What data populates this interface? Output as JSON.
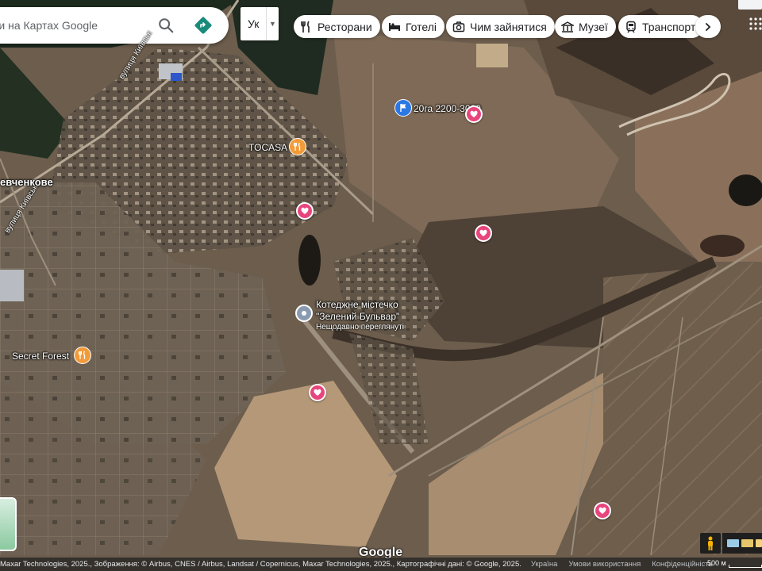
{
  "search": {
    "placeholder": "ти на Картах Google"
  },
  "language": {
    "selected": "Ук"
  },
  "chips": [
    {
      "label": "Ресторани",
      "icon": "fork-knife-icon"
    },
    {
      "label": "Готелі",
      "icon": "bed-icon"
    },
    {
      "label": "Чим зайнятися",
      "icon": "camera-icon"
    },
    {
      "label": "Музеї",
      "icon": "museum-icon"
    },
    {
      "label": "Транспорт",
      "icon": "train-icon"
    }
  ],
  "map": {
    "labels": {
      "tocasa": "TOCASA",
      "shevchenkove": "евченкове",
      "secret_forest": "Secret Forest",
      "flag_place": "20га 2200-3000",
      "recent_title_1": "Котеджне містечко",
      "recent_title_2": "\"Зелений Бульвар\"",
      "recent_sub": "Нещодавно переглянуті",
      "road_kyivska_1": "вулиця Київськ",
      "road_kyivska_2": "вулиця Київська"
    }
  },
  "attribution": {
    "imagery": "Maxar Technologies, 2025., Зображення: © Airbus, CNES / Airbus, Landsat / Copernicus, Maxar Technologies, 2025., Картографічні дані: © Google, 2025.",
    "country": "Україна",
    "terms": "Умови використання",
    "privacy": "Конфіденційність",
    "scale": "500 м"
  },
  "logo": "Google",
  "colors": {
    "fav_pin": "#e8457c",
    "food_pin": "#f29b38",
    "flag_pin": "#2b78e4",
    "directions": "#1a8a7a"
  }
}
